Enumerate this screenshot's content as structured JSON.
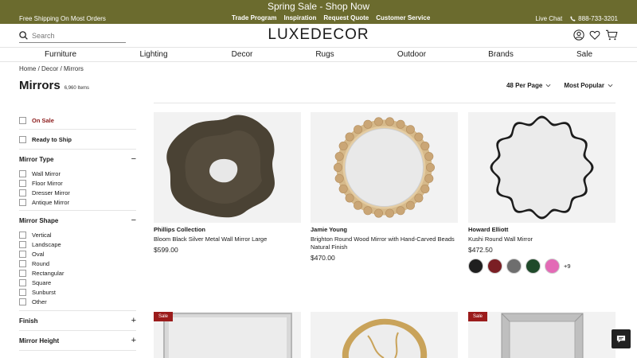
{
  "promo": {
    "free_shipping": "Free Shipping On Most Orders",
    "headline": "Spring Sale - Shop Now",
    "links": [
      "Trade Program",
      "Inspiration",
      "Request Quote",
      "Customer Service"
    ],
    "live_chat": "Live Chat",
    "phone": "888-733-3201"
  },
  "header": {
    "search_placeholder": "Search",
    "logo": "LUXEDECOR"
  },
  "nav": [
    "Furniture",
    "Lighting",
    "Decor",
    "Rugs",
    "Outdoor",
    "Brands",
    "Sale"
  ],
  "breadcrumb": "Home / Decor / Mirrors",
  "page": {
    "title": "Mirrors",
    "count": "6,960 Items",
    "per_page": "48 Per Page",
    "sort": "Most Popular"
  },
  "filters": {
    "on_sale": "On Sale",
    "ready_to_ship": "Ready to Ship",
    "mirror_type": {
      "title": "Mirror Type",
      "toggle": "−",
      "options": [
        "Wall Mirror",
        "Floor Mirror",
        "Dresser Mirror",
        "Antique Mirror"
      ]
    },
    "mirror_shape": {
      "title": "Mirror Shape",
      "toggle": "−",
      "options": [
        "Vertical",
        "Landscape",
        "Oval",
        "Round",
        "Rectangular",
        "Square",
        "Sunburst",
        "Other"
      ]
    },
    "finish": {
      "title": "Finish",
      "toggle": "+"
    },
    "mirror_height": {
      "title": "Mirror Height",
      "toggle": "+"
    }
  },
  "products": [
    {
      "brand": "Phillips Collection",
      "name": "Bloom Black Silver Metal Wall Mirror Large",
      "price": "$599.00"
    },
    {
      "brand": "Jamie Young",
      "name": "Brighton Round Wood Mirror with Hand-Carved Beads Natural Finish",
      "price": "$470.00"
    },
    {
      "brand": "Howard Elliott",
      "name": "Kushi Round Wall Mirror",
      "price": "$472.50",
      "swatches": [
        "#1f1f1f",
        "#7a1e24",
        "#6e6e6e",
        "#1f4a2a",
        "#e36ab6"
      ],
      "more_swatches": "+9"
    }
  ],
  "row2": {
    "sale_label": "Sale"
  },
  "colors": {
    "promo_bar": "#6b6b2e",
    "sale_red": "#8b1a1a"
  }
}
